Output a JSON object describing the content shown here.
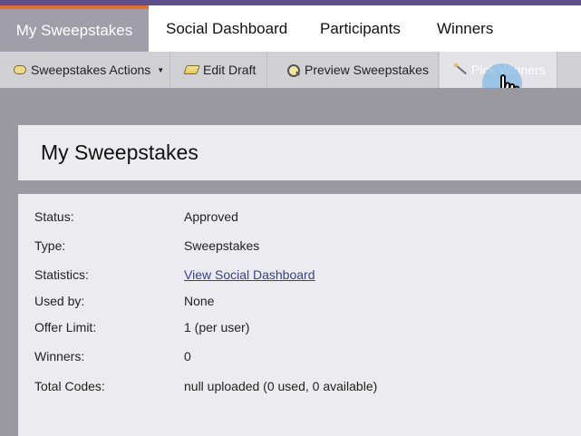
{
  "tabs": [
    {
      "label": "My Sweepstakes",
      "active": true
    },
    {
      "label": "Social Dashboard",
      "active": false
    },
    {
      "label": "Participants",
      "active": false
    },
    {
      "label": "Winners",
      "active": false
    }
  ],
  "toolbar": {
    "actions_label": "Sweepstakes Actions",
    "edit_label": "Edit Draft",
    "preview_label": "Preview Sweepstakes",
    "pick_label": "Pick Winners"
  },
  "page": {
    "title": "My Sweepstakes"
  },
  "details": [
    {
      "label": "Status:",
      "value": "Approved"
    },
    {
      "label": "Type:",
      "value": "Sweepstakes"
    },
    {
      "label": "Statistics:",
      "value": "View Social Dashboard",
      "is_link": true
    },
    {
      "label": "Used by:",
      "value": "None"
    },
    {
      "label": "Offer Limit:",
      "value": "1 (per user)"
    },
    {
      "label": "Winners:",
      "value": "0"
    },
    {
      "label": "Total Codes:",
      "value": "null uploaded (0 used, 0 available)"
    }
  ],
  "colors": {
    "accent_purple": "#5d4e8c",
    "active_tab_border": "#e46f2b",
    "active_tab_bg": "#a09ea8",
    "toolbar_bg": "#d1d1d5",
    "content_bg": "#9a999f",
    "card_bg": "#ecebef",
    "link": "#3a3f8f"
  },
  "icons": {
    "actions": "cloud-icon",
    "edit": "pencil-icon",
    "preview": "magnifier-icon",
    "pick": "magic-wand-icon",
    "cursor": "hand-pointer-cursor"
  }
}
